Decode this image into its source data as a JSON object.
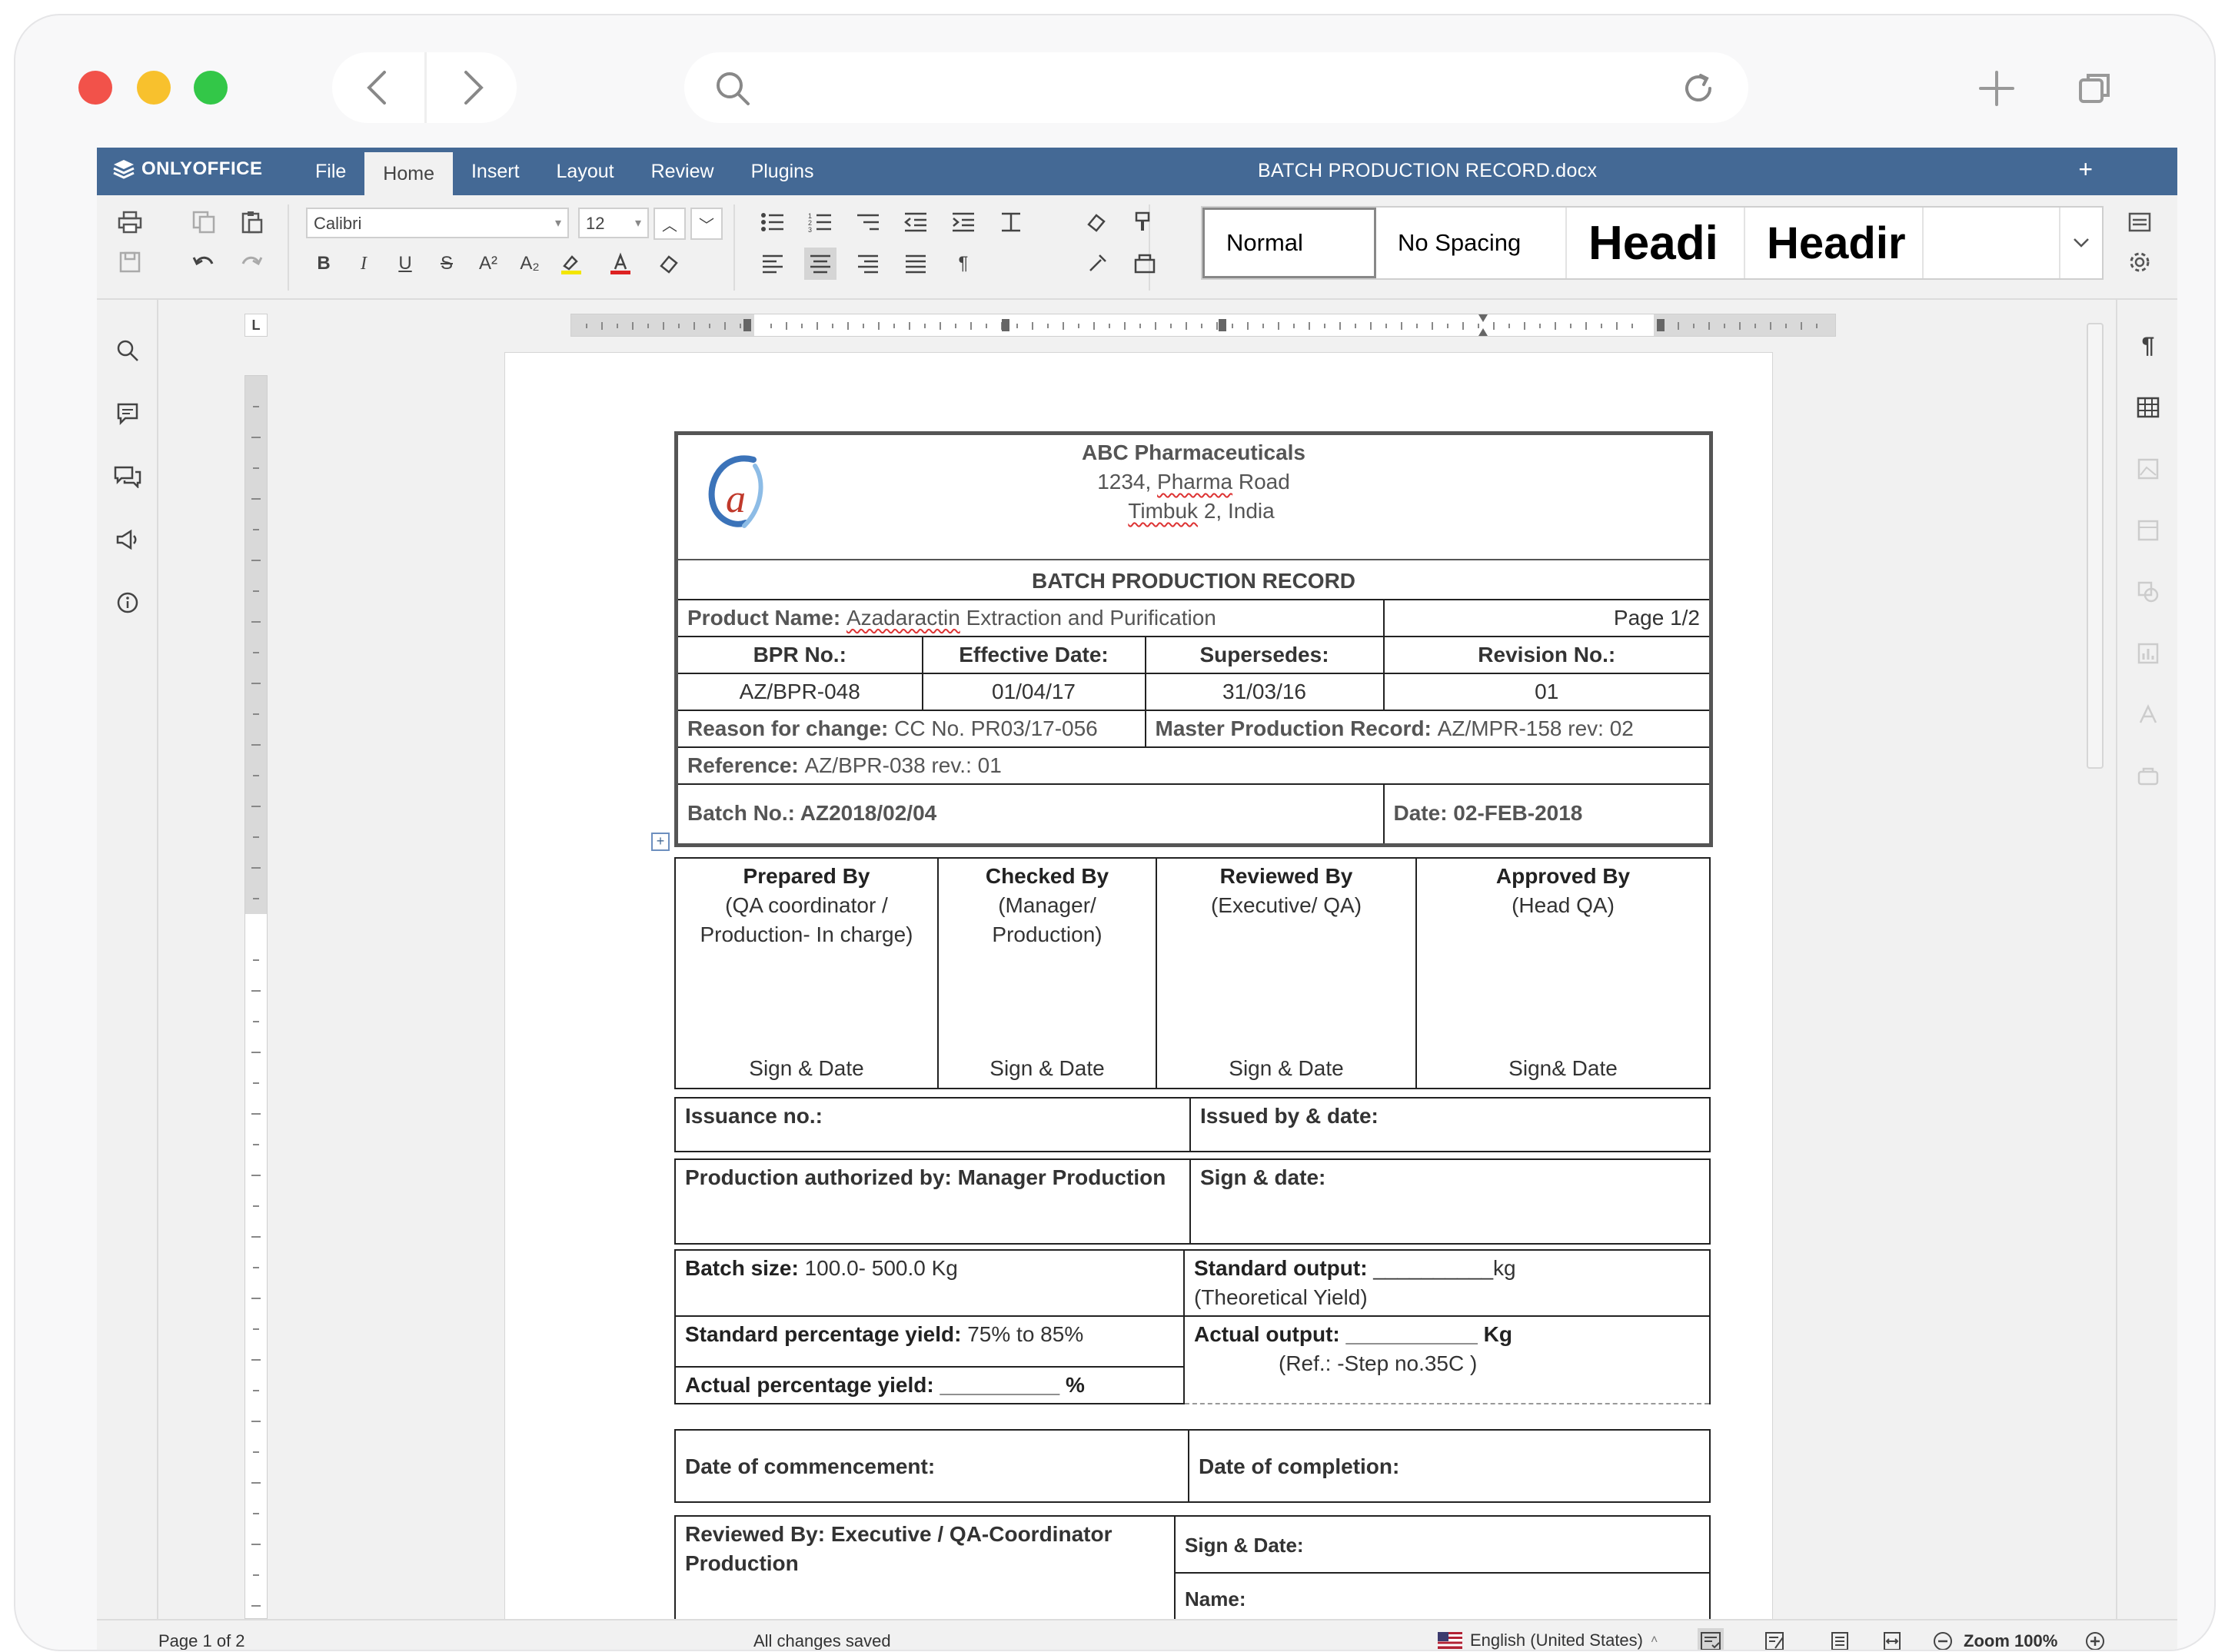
{
  "browser": {
    "nav_back_icon": "chevron-left-icon",
    "nav_forward_icon": "chevron-right-icon",
    "url": ""
  },
  "app": {
    "brand": "ONLYOFFICE",
    "menu_tabs": [
      {
        "label": "File"
      },
      {
        "label": "Home",
        "active": true
      },
      {
        "label": "Insert"
      },
      {
        "label": "Layout"
      },
      {
        "label": "Review"
      },
      {
        "label": "Plugins"
      }
    ],
    "doc_title": "BATCH PRODUCTION RECORD.docx",
    "new_tab_label": "+"
  },
  "toolbar": {
    "font_name": "Calibri",
    "font_size": "12",
    "styles": [
      {
        "label": "Normal"
      },
      {
        "label": "No Spacing"
      },
      {
        "label": "Headi"
      },
      {
        "label": "Headir"
      }
    ],
    "ruler_corner": "L"
  },
  "document": {
    "company": {
      "name": "ABC Pharmaceuticals",
      "address_prefix": "1234, ",
      "address_street": "Pharma",
      "address_suffix": " Road",
      "city": "Timbuk",
      "city_suffix": " 2, India"
    },
    "record_title": "BATCH PRODUCTION RECORD",
    "product_label": "Product Name: ",
    "product_squiggle": "Azadaractin",
    "product_rest": " Extraction and Purification",
    "page_label": "Page 1/2",
    "headers": {
      "bpr": "BPR No.:",
      "effective": "Effective Date:",
      "supersedes": "Supersedes:",
      "revision": "Revision No.:"
    },
    "values": {
      "bpr": "AZ/BPR-048",
      "effective": "01/04/17",
      "supersedes": "31/03/16",
      "revision": "01"
    },
    "reason_label": "Reason for change: ",
    "reason_value": "CC No. PR03/17-056",
    "mpr_label": "Master Production Record: ",
    "mpr_value": "AZ/MPR-158 rev: 02",
    "reference_label": "Reference: ",
    "reference_value": "AZ/BPR-038 rev.: 01",
    "batch_label": "Batch No.: ",
    "batch_value": "AZ2018/02/04",
    "date_label": "Date: ",
    "date_value": "02-FEB-2018",
    "signatories": [
      {
        "title": "Prepared  By",
        "sub1": "(QA coordinator /",
        "sub2": "Production- In charge)",
        "foot": "Sign & Date"
      },
      {
        "title": "Checked By",
        "sub1": "(Manager/",
        "sub2": "Production)",
        "foot": "Sign & Date"
      },
      {
        "title": "Reviewed By",
        "sub1": "(Executive/ QA)",
        "sub2": "",
        "foot": "Sign & Date"
      },
      {
        "title": "Approved By",
        "sub1": "(Head QA)",
        "sub2": "",
        "foot": "Sign&  Date"
      }
    ],
    "issuance_label": "Issuance no.:",
    "issued_by_label": "Issued by & date:",
    "prod_auth_label": "Production authorized by: Manager Production",
    "sign_date_label": "Sign & date:",
    "batch_size_label": "Batch size: ",
    "batch_size_value": "100.0- 500.0 Kg",
    "std_output_label": "Standard output: ",
    "std_output_blank": "__________kg",
    "std_output_note": "(Theoretical Yield)",
    "std_yield_label": "Standard percentage yield: ",
    "std_yield_value": "75% to 85%",
    "actual_output_label": "Actual output: ",
    "actual_output_blank": "___________ Kg",
    "actual_output_note": "(Ref.: -Step no.35C )",
    "actual_yield_label": "Actual percentage yield: ",
    "actual_yield_blank": "__________ %",
    "commencement_label": "Date of commencement:",
    "completion_label": "Date of completion:",
    "reviewed_label": "Reviewed By: Executive / QA-Coordinator Production",
    "reviewed_sign_label": "Sign & Date:",
    "reviewed_name_label": "Name:"
  },
  "status": {
    "page_count": "Page 1 of 2",
    "save_state": "All changes saved",
    "language": "English (United States)",
    "zoom": "Zoom 100%"
  },
  "colors": {
    "titlebar": "#446995",
    "accent": "#446995"
  }
}
